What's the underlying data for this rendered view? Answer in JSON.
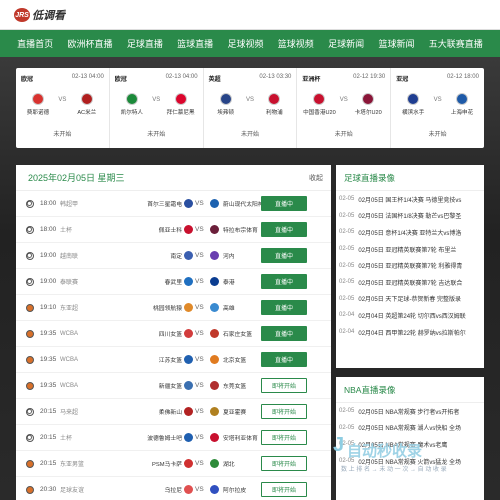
{
  "logo": {
    "badge": "JRS",
    "text": "低调看"
  },
  "nav": [
    "直播首页",
    "欧洲杯直播",
    "足球直播",
    "篮球直播",
    "足球视频",
    "篮球视频",
    "足球新闻",
    "篮球新闻",
    "五大联赛直播"
  ],
  "cards": [
    {
      "league": "欧冠",
      "time": "02-13 04:00",
      "home": "费耶诺德",
      "away": "AC米兰",
      "status": "未开始",
      "hc": "#d8322f",
      "ac": "#b01e1e"
    },
    {
      "league": "欧冠",
      "time": "02-13 04:00",
      "home": "凯尔特人",
      "away": "拜仁慕尼黑",
      "status": "未开始",
      "hc": "#1b8a3a",
      "ac": "#dc052d"
    },
    {
      "league": "英超",
      "time": "02-13 03:30",
      "home": "埃弗顿",
      "away": "利物浦",
      "status": "未开始",
      "hc": "#274488",
      "ac": "#c8102e"
    },
    {
      "league": "亚洲杯",
      "time": "02-12 19:30",
      "home": "中国香港U20",
      "away": "卡塔尔U20",
      "status": "未开始",
      "hc": "#c8102e",
      "ac": "#8a1538"
    },
    {
      "league": "亚冠",
      "time": "02-12 18:00",
      "home": "横滨水手",
      "away": "上海申花",
      "status": "未开始",
      "hc": "#1f3e91",
      "ac": "#1e5aa8"
    }
  ],
  "schedule": {
    "title": "2025年02月05日 星期三",
    "more": "收起",
    "rows": [
      {
        "sport": "soccer",
        "time": "18:00",
        "league": "韩超甲",
        "home": "首尔三星霜电",
        "away": "蔚山现代太阳神",
        "btn": "直播中",
        "live": true,
        "hc": "#2a4fa0",
        "ac": "#1d62b0"
      },
      {
        "sport": "soccer",
        "time": "18:00",
        "league": "土杯",
        "home": "佩亚士科",
        "away": "特拉布宗体育",
        "btn": "直播中",
        "live": true,
        "hc": "#c8102e",
        "ac": "#6b1f3a"
      },
      {
        "sport": "soccer",
        "time": "19:00",
        "league": "越南联",
        "home": "南定",
        "away": "河内",
        "btn": "直播中",
        "live": true,
        "hc": "#3b5fb0",
        "ac": "#6a3fb0"
      },
      {
        "sport": "soccer",
        "time": "19:00",
        "league": "泰联赛",
        "home": "春武里",
        "away": "泰港",
        "btn": "直播中",
        "live": true,
        "hc": "#1f6fc0",
        "ac": "#0b3d91"
      },
      {
        "sport": "basket",
        "time": "19:10",
        "league": "东亚超",
        "home": "桃园领航猿",
        "away": "高雄",
        "btn": "直播中",
        "live": true,
        "hc": "#e08a2a",
        "ac": "#3a8ad0"
      },
      {
        "sport": "basket",
        "time": "19:35",
        "league": "WCBA",
        "home": "四川女篮",
        "away": "石家庄女篮",
        "btn": "直播中",
        "live": true,
        "hc": "#d23c3c",
        "ac": "#c0392b"
      },
      {
        "sport": "basket",
        "time": "19:35",
        "league": "WCBA",
        "home": "江苏女篮",
        "away": "北京女篮",
        "btn": "直播中",
        "live": true,
        "hc": "#2060b0",
        "ac": "#e07b20"
      },
      {
        "sport": "basket",
        "time": "19:35",
        "league": "WCBA",
        "home": "新疆女篮",
        "away": "东莞女篮",
        "btn": "即将开始",
        "live": false,
        "hc": "#3a6fb0",
        "ac": "#b03030"
      },
      {
        "sport": "soccer",
        "time": "20:15",
        "league": "马来超",
        "home": "柔佛新山",
        "away": "夏亚霍赛",
        "btn": "即将开始",
        "live": false,
        "hc": "#b22222",
        "ac": "#b08020"
      },
      {
        "sport": "soccer",
        "time": "20:15",
        "league": "土杯",
        "home": "波德鲁姆士吧",
        "away": "安塔利亚体育",
        "btn": "即将开始",
        "live": false,
        "hc": "#1f5fb0",
        "ac": "#c8102e"
      },
      {
        "sport": "basket",
        "time": "20:15",
        "league": "东亚男篮",
        "home": "PSM马卡萨",
        "away": "湖北",
        "btn": "即将开始",
        "live": false,
        "hc": "#d03030",
        "ac": "#2e8b3a"
      },
      {
        "sport": "basket",
        "time": "20:30",
        "league": "足球友谊",
        "home": "乌拉尼",
        "away": "阿尔拉皮",
        "btn": "即将开始",
        "live": false,
        "hc": "#e05050",
        "ac": "#3050c0"
      }
    ]
  },
  "football_replays": {
    "title": "足球直播录像",
    "items": [
      {
        "d": "02-05",
        "t": "02月05日 国王杯1/4决赛 马德里竞技vs"
      },
      {
        "d": "02-05",
        "t": "02月05日 法国杯1/8决赛 勒芒vs巴黎圣"
      },
      {
        "d": "02-05",
        "t": "02月05日 意杯1/4决赛 亚特兰大vs博洛"
      },
      {
        "d": "02-05",
        "t": "02月05日 亚冠精英联赛第7轮 布里兰"
      },
      {
        "d": "02-05",
        "t": "02月05日 亚冠精英联赛第7轮 利雅得青"
      },
      {
        "d": "02-05",
        "t": "02月05日 亚冠精英联赛第7轮 吉达联合"
      },
      {
        "d": "02-05",
        "t": "02月05日 天下足球-恭贺新春 完整版录"
      },
      {
        "d": "02-04",
        "t": "02月04日 英超第24轮 切尔西vs西汉姆联"
      },
      {
        "d": "02-04",
        "t": "02月04日 西甲第22轮 赫罗纳vs拉斯帕尔"
      }
    ]
  },
  "nba_replays": {
    "title": "NBA直播录像",
    "items": [
      {
        "d": "02-05",
        "t": "02月05日 NBA常规赛 步行者vs开拓者"
      },
      {
        "d": "02-05",
        "t": "02月05日 NBA常规赛 湖人vs快船 全场"
      },
      {
        "d": "02-05",
        "t": "02月05日 NBA常规赛 魔术vs老鹰"
      },
      {
        "d": "02-05",
        "t": "02月05日 NBA常规赛 火箭vs猛龙 全场"
      }
    ]
  },
  "watermark": {
    "big": "自动秒收录",
    "small": "数 上 排 名 → 未 动 一 次 → 自 动 收 录"
  }
}
